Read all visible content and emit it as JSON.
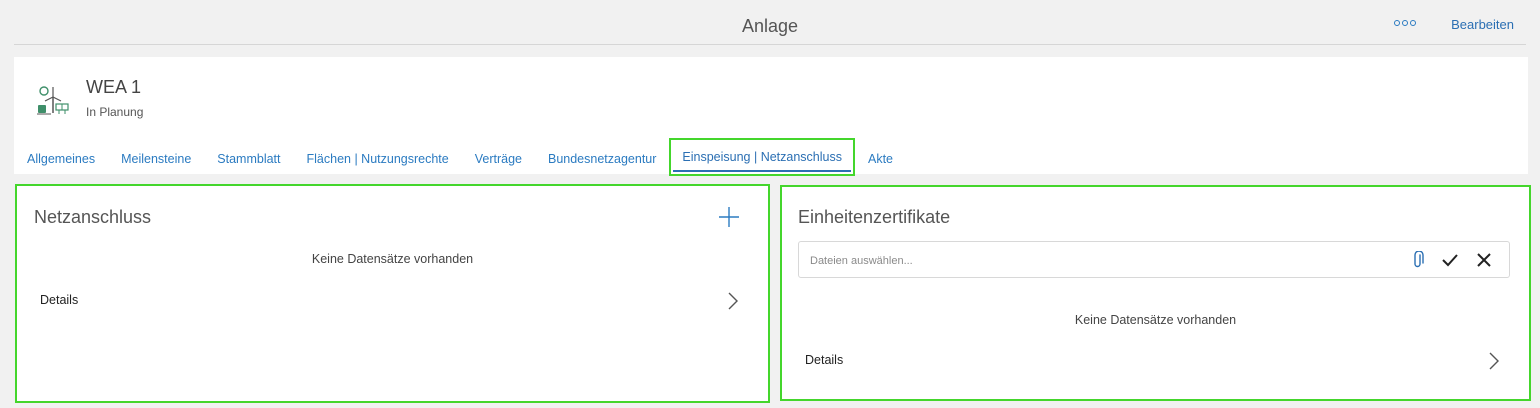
{
  "page": {
    "title": "Anlage"
  },
  "header_actions": {
    "more_icon": "more-horizontal-icon",
    "edit_label": "Bearbeiten"
  },
  "asset": {
    "name": "WEA 1",
    "status": "In Planung",
    "icon": "wind-solar-plant-icon"
  },
  "tabs": [
    {
      "label": "Allgemeines"
    },
    {
      "label": "Meilensteine"
    },
    {
      "label": "Stammblatt"
    },
    {
      "label": "Flächen | Nutzungsrechte"
    },
    {
      "label": "Verträge"
    },
    {
      "label": "Bundesnetzagentur"
    },
    {
      "label": "Einspeisung | Netzanschluss",
      "active": true
    },
    {
      "label": "Akte"
    }
  ],
  "netzanschluss": {
    "title": "Netzanschluss",
    "empty_text": "Keine Datensätze vorhanden",
    "details_label": "Details"
  },
  "einheitenzertifikate": {
    "title": "Einheitenzertifikate",
    "file_placeholder": "Dateien auswählen...",
    "empty_text": "Keine Datensätze vorhanden",
    "details_label": "Details"
  },
  "colors": {
    "accent": "#2b7bc1",
    "highlight": "#44d62c",
    "background": "#f1f1f1"
  }
}
